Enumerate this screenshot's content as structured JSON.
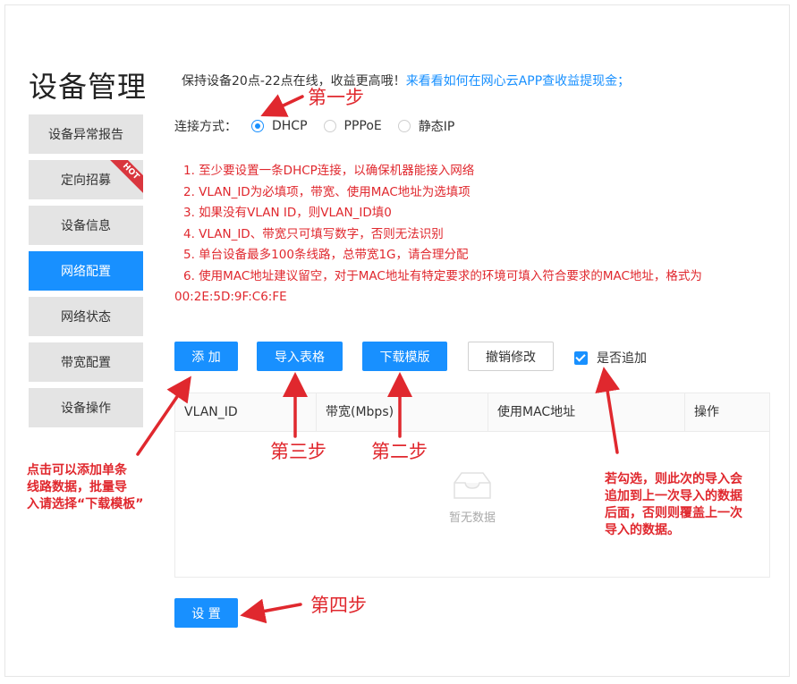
{
  "page": {
    "title": "设备管理"
  },
  "sidebar": {
    "items": [
      {
        "label": "设备异常报告",
        "active": false
      },
      {
        "label": "定向招募",
        "active": false,
        "badge": "HOT"
      },
      {
        "label": "设备信息",
        "active": false
      },
      {
        "label": "网络配置",
        "active": true
      },
      {
        "label": "网络状态",
        "active": false
      },
      {
        "label": "带宽配置",
        "active": false
      },
      {
        "label": "设备操作",
        "active": false
      }
    ]
  },
  "notice": {
    "text": "保持设备20点-22点在线，收益更高哦！",
    "link": "来看看如何在网心云APP查收益提现金；"
  },
  "connection": {
    "label": "连接方式：",
    "options": [
      "DHCP",
      "PPPoE",
      "静态IP"
    ],
    "selected": "DHCP"
  },
  "rules": [
    "1. 至少要设置一条DHCP连接，以确保机器能接入网络",
    "2. VLAN_ID为必填项，带宽、使用MAC地址为选填项",
    "3. 如果没有VLAN ID，则VLAN_ID填0",
    "4. VLAN_ID、带宽只可填写数字，否则无法识别",
    "5. 单台设备最多100条线路，总带宽1G，请合理分配",
    "6. 使用MAC地址建议留空，对于MAC地址有特定要求的环境可填入符合要求的MAC地址，格式为",
    "00:2E:5D:9F:C6:FE"
  ],
  "toolbar": {
    "add": "添 加",
    "import": "导入表格",
    "download": "下载模版",
    "revert": "撤销修改",
    "append_label": "是否追加",
    "append_checked": true
  },
  "table": {
    "columns": [
      "VLAN_ID",
      "带宽(Mbps)",
      "使用MAC地址",
      "操作"
    ],
    "empty_text": "暂无数据"
  },
  "submit_label": "设 置",
  "annotations": {
    "step1": "第一步",
    "step2": "第二步",
    "step3": "第三步",
    "step4": "第四步",
    "add_note": [
      "点击可以添加单条",
      "线路数据，批量导",
      "入请选择“下载模板”"
    ],
    "append_note": [
      "若勾选，则此次的导入会",
      "追加到上一次导入的数据",
      "后面，否则则覆盖上一次",
      "导入的数据。"
    ]
  },
  "colors": {
    "accent": "#1890ff",
    "annotation": "#e0282e",
    "hot_badge": "#d9363e"
  }
}
